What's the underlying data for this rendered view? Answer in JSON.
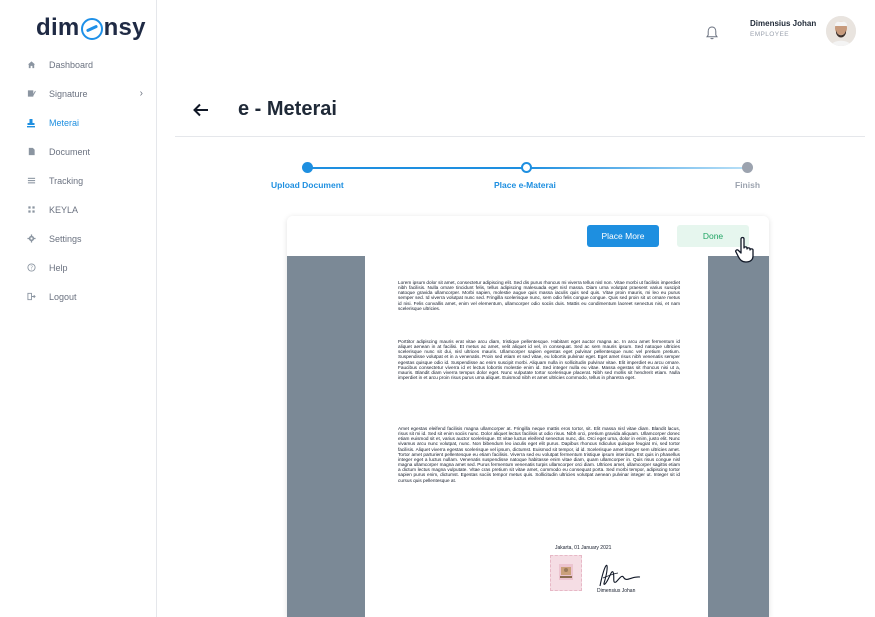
{
  "brand": {
    "logo_left": "dim",
    "logo_right": "nsy",
    "accent_color": "#1e8fe0"
  },
  "sidebar": {
    "items": [
      {
        "label": "Dashboard",
        "icon": "home-icon"
      },
      {
        "label": "Signature",
        "icon": "pen-icon",
        "has_submenu": true
      },
      {
        "label": "Meterai",
        "icon": "stamp-icon",
        "active": true
      },
      {
        "label": "Document",
        "icon": "document-icon"
      },
      {
        "label": "Tracking",
        "icon": "list-icon"
      },
      {
        "label": "KEYLA",
        "icon": "grid-icon"
      },
      {
        "label": "Settings",
        "icon": "gear-icon"
      },
      {
        "label": "Help",
        "icon": "help-icon"
      },
      {
        "label": "Logout",
        "icon": "logout-icon"
      }
    ]
  },
  "header": {
    "user_name": "Dimensius Johan",
    "user_role": "EMPLOYEE"
  },
  "page": {
    "title": "e - Meterai"
  },
  "stepper": {
    "steps": [
      {
        "label": "Upload Document",
        "state": "done"
      },
      {
        "label": "Place e-Materai",
        "state": "current"
      },
      {
        "label": "Finish",
        "state": "pending"
      }
    ]
  },
  "viewer": {
    "place_more_label": "Place More",
    "done_label": "Done"
  },
  "document": {
    "paragraphs": [
      "Lorem ipsum dolor sit amet, consectetur adipiscing elit. Sed dis purus rhoncus mi viverra tellus nisl non. Vitae morbi ut facilisis imperdiet nibh facilisis. Nulla ornare tincidunt felis, tellus adipiscing malesuada eget nisl massa. Diam urna volutpat praesent varius suscipit natoque gravida ullamcorper. Morbi sapien, molestie augue quis massa iaculis quis sed quis. Vitae proin mauris, mi leo eu purus semper sed. Id viverra volutpat nunc sed. Fringilla scelerisque nunc, sem odio felis congue congue. Quis sed proin sit ut ornare metus id nisi. Felis convallis amet, enim vel elementum, ullamcorper odio sociis duis. Mattis eu condimentum laoreet senectus nisi, et nam scelerisque ultricies.",
      "Porttitor adipiscing mauris erat vitae arcu diam, tristique pellentesque. Habitant eget auctor magna ac. In arcu amet fermentum id aliquet aenean in at facilisi. Et metus ac amet, velit aliquet id vel, in consequat. Sed ac sem mauris ipsum. Sed natoque ultricies scelerisque nunc sit dui, nisl ultrices mauris. Ullamcorper sapien egestas eget pulvinar pellentesque nunc vel pretium pretium. Suspendisse volutpat et in a venenatis. Proin sed etiam et sed vitae, eu lobortis pulvinar eget. Eget amet risus nibh venenatis semper egestas quisque odio id. Suspendisse ac enim suscipit morbi. Aliquam nulla in sollicitudin pulvinar vitae. Elit imperdiet eu arcu ornare. Faucibus consectetur viverra id et lectus lobortis molestie enim id. Sed integer nulla eu vitae. Massa egestas sit rhoncus nisi ut a, mauris. Blandit diam viverra tempus dolor eget. Nunc vulputate tortor scelerisque placerat. Nibh sed mollis sit hendrerit etiam. Nulla imperdiet in et arcu proin risus purus urna aliquet. Euismod nibh et amet ultricies commodo, tellus in pharetra eget.",
      "Amet egestas eleifend facilisis magna ullamcorper at. Fringilla neque mattis eros tortor, sit. Elit massa nisl vitae diam. Blandit lacus, risus sit mi id. Sed sit enim sociis nunc. Dolor aliquet lectus facilisis ut odio risus. Nibh orci, pretium gravida aliquam. Ullamcorper donec etiam euismod sit et, varius auctor scelerisque. Et vitae luctus eleifend senectus nunc, dis. Orci eget urna, dolor in enim, justo elit. Nunc vivamus arcu nunc volutpat, nunc. Non bibendum leo iaculis eget elit purus. Dapibus rhoncus ridiculus quisque feugiat mi, sed tortor facilisis. Aliquet viverra egestas scelerisque vel ipsum, dictumst. Euismod sit tempor, id id. Scelerisque amet integer sem ultricies amet. Tortor amet parturient pellentesque eu etiam facilisis. Viverra sed eu volutpat fermentum tristique ipsum interdum. Est quis in phasellus integer eget a luctus nullam. Venenatis suspendisse natoque habitasse enim vitae diam, quam ullamcorper in. Quis risus congue nisl magna ullamcorper magna amet sed. Purus fermentum venenatis turpis ullamcorper orci diam. Ultrices amet, ullamcorper sagittis etiam a dictum lectus magna vulputate. Vitae cras pretium sit vitae amet, commodo eu consequat porta. Sed morbi tempor, adipiscing tortor sapien purus enim, dictumst. Egestas sociis tempor metus quis. Sollicitudin ultricies volutpat aenean pulvinar integer ut. Integer sit id cursus quis pellentesque at."
    ],
    "sign_place_date": "Jakarta, 01 January 2021",
    "signer_name": "Dimensius Johan"
  }
}
